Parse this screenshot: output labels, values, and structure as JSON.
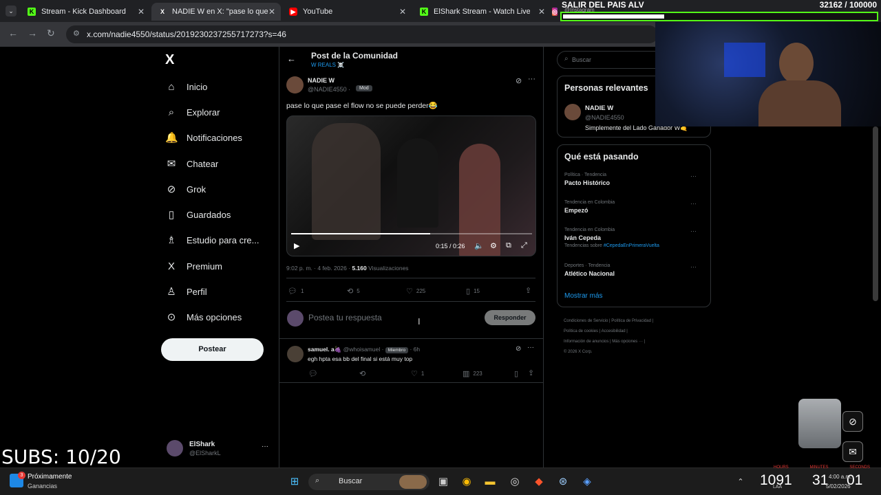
{
  "browser": {
    "tabs": [
      {
        "label": "Stream - Kick Dashboard",
        "icon": "kick-icon",
        "active": false
      },
      {
        "label": "NADIE W en X: \"pase lo que pa",
        "icon": "x-icon",
        "active": true
      },
      {
        "label": "YouTube",
        "icon": "youtube-icon",
        "active": false
      },
      {
        "label": "ElShark Stream - Watch Live on",
        "icon": "kick-icon",
        "active": false
      },
      {
        "label": "",
        "icon": "instagram-icon",
        "active": false
      }
    ],
    "url": "x.com/nadie4550/status/2019230237255717273?s=46"
  },
  "overlay": {
    "goal_title": "SALIR DEL PAIS ALV",
    "goal_count": "32162 / 100000",
    "goal_fraction": 0.32,
    "subs": "SUBS: 10/20",
    "webcam_caption": "@Instagram"
  },
  "nav": {
    "logo": "X",
    "items": [
      {
        "label": "Inicio",
        "icon": "home-icon",
        "glyph": "⌂"
      },
      {
        "label": "Explorar",
        "icon": "search-icon",
        "glyph": "⌕"
      },
      {
        "label": "Notificaciones",
        "icon": "bell-icon",
        "glyph": "🔔"
      },
      {
        "label": "Chatear",
        "icon": "mail-icon",
        "glyph": "✉"
      },
      {
        "label": "Grok",
        "icon": "grok-icon",
        "glyph": "⊘"
      },
      {
        "label": "Guardados",
        "icon": "bookmark-icon",
        "glyph": "▯"
      },
      {
        "label": "Estudio para cre...",
        "icon": "studio-icon",
        "glyph": "♗"
      },
      {
        "label": "Premium",
        "icon": "x-premium-icon",
        "glyph": "X"
      },
      {
        "label": "Perfil",
        "icon": "person-icon",
        "glyph": "♙"
      },
      {
        "label": "Más opciones",
        "icon": "more-circle-icon",
        "glyph": "⊙"
      }
    ],
    "post_button": "Postear",
    "account_name": "ElShark",
    "account_handle": "@ElSharkL"
  },
  "header": {
    "title": "Post de la Comunidad",
    "community": "W REALS ☠️"
  },
  "post": {
    "author": "NADIE W",
    "handle": "@NADIE4550 ·",
    "badge": "Mod",
    "text": "pase lo que pase el flow no se puede perder😂",
    "video_time": "0:15 / 0:26",
    "video_progress": 0.577,
    "timestamp": "9:02 p. m. · 4 feb. 2026 ·",
    "views_count": "5.160",
    "views_label": "Visualizaciones",
    "replies": "1",
    "reposts": "5",
    "likes": "225",
    "bookmarks": "15"
  },
  "reply_box": {
    "placeholder": "Postea tu respuesta",
    "button": "Responder"
  },
  "reply": {
    "author": "samuel. a🍇",
    "handle": "@whoisamuel ·",
    "badge": "Miembro",
    "time": "· 6h",
    "text": "egh hpta esa bb del final si está muy top",
    "likes": "1",
    "views": "223"
  },
  "right": {
    "search_placeholder": "Buscar",
    "relevant_title": "Personas relevantes",
    "relevant_name": "NADIE W",
    "relevant_handle": "@NADIE4550",
    "relevant_bio": "Simplemente del Lado Ganador W🤙",
    "trends_title": "Qué está pasando",
    "trends": [
      {
        "category": "Política · Tendencia",
        "name": "Pacto Histórico",
        "extra_label": "",
        "extra_link": ""
      },
      {
        "category": "Tendencia en Colombia",
        "name": "Empezó",
        "extra_label": "",
        "extra_link": ""
      },
      {
        "category": "Tendencia en Colombia",
        "name": "Iván Cepeda",
        "extra_label": "Tendencias sobre",
        "extra_link": "#CepedaEnPrimeraVuelta"
      },
      {
        "category": "Deportes · Tendencia",
        "name": "Atlético Nacional",
        "extra_label": "",
        "extra_link": ""
      }
    ],
    "show_more": "Mostrar más",
    "footer": [
      "Condiciones de Servicio",
      "Política de Privacidad",
      "Política de cookies",
      "Accesibilidad",
      "Información de anuncios",
      "Más opciones ···",
      "© 2026 X Corp."
    ]
  },
  "taskbar": {
    "notif_title": "Próximamente",
    "notif_sub": "Ganancias",
    "notif_badge": "3",
    "search": "Buscar",
    "timer_labels": [
      "HOURS",
      "MINUTES",
      "SECONDS"
    ],
    "timer_values": [
      "1091",
      "31",
      "01"
    ],
    "lang": "LAA",
    "clock_time": "4:00 a.m.",
    "clock_date": "5/02/2026"
  },
  "colors": {
    "accent": "#1d9bf0",
    "kick_green": "#53fc18",
    "bg": "#000000",
    "border": "#2f3336"
  }
}
